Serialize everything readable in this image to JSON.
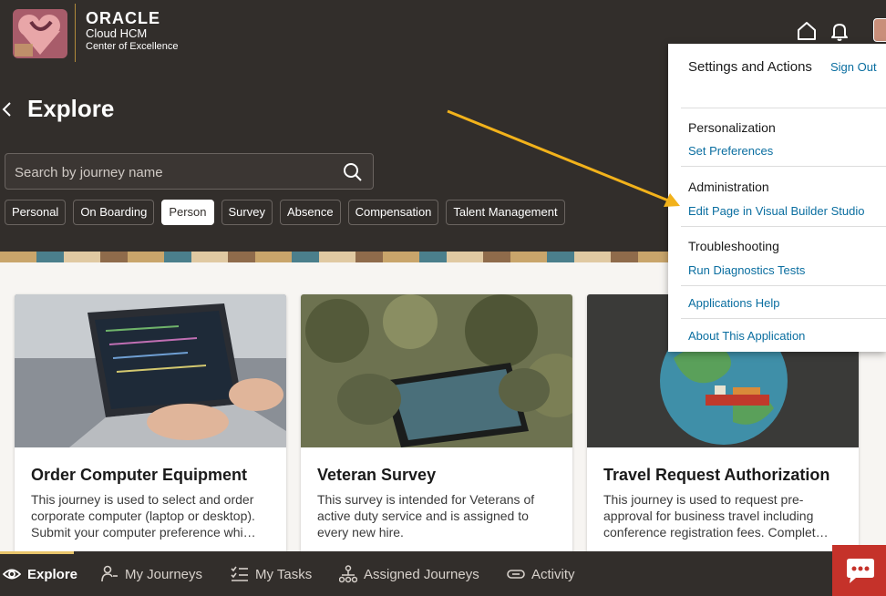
{
  "header": {
    "brand_line1": "ORACLE",
    "brand_line2": "Cloud HCM",
    "brand_line3": "Center of Excellence"
  },
  "page": {
    "title": "Explore"
  },
  "search": {
    "placeholder": "Search by journey name"
  },
  "chips": [
    "Personal",
    "On Boarding",
    "Person",
    "Survey",
    "Absence",
    "Compensation",
    "Talent Management"
  ],
  "active_chip": "Person",
  "cards": [
    {
      "title": "Order Computer Equipment",
      "description": "This journey is used to select and order corporate computer (laptop or desktop). Submit your computer preference whi…"
    },
    {
      "title": "Veteran Survey",
      "description": "This survey is intended for Veterans of active duty service and is assigned to every new hire."
    },
    {
      "title": "Travel Request Authorization",
      "description": "This journey is used to request pre-approval for business travel including conference registration fees. Complet…"
    }
  ],
  "bottom_nav": [
    {
      "label": "Explore",
      "icon": "eye-icon"
    },
    {
      "label": "My Journeys",
      "icon": "person-path-icon"
    },
    {
      "label": "My Tasks",
      "icon": "checklist-icon"
    },
    {
      "label": "Assigned Journeys",
      "icon": "hierarchy-icon"
    },
    {
      "label": "Activity",
      "icon": "link-icon"
    }
  ],
  "menu": {
    "heading": "Settings and Actions",
    "sign_out": "Sign Out",
    "personalization": "Personalization",
    "set_preferences": "Set Preferences",
    "administration": "Administration",
    "edit_page": "Edit Page in Visual Builder Studio",
    "troubleshooting": "Troubleshooting",
    "run_diagnostics": "Run Diagnostics Tests",
    "applications_help": "Applications Help",
    "about_app": "About This Application"
  },
  "colors": {
    "header_bg": "#322e2b",
    "link": "#0a6ea0",
    "annotation_arrow": "#f2b21b",
    "chat_button": "#c5322a"
  }
}
